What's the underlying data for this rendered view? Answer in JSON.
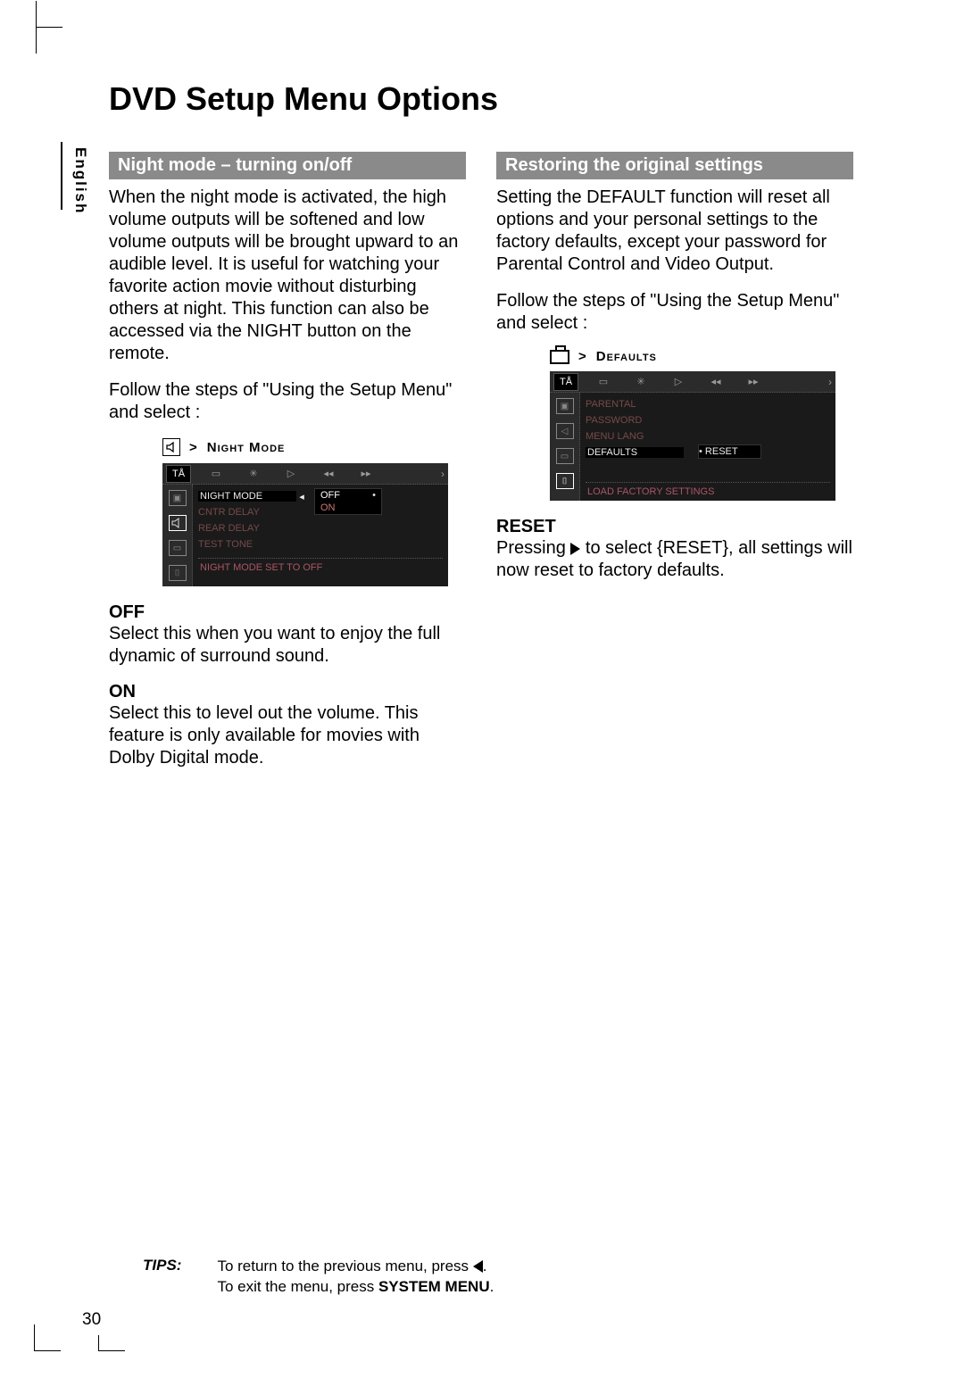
{
  "page": {
    "language": "English",
    "title": "DVD Setup Menu Options",
    "number": "30"
  },
  "left": {
    "heading": "Night mode – turning on/off",
    "p1": "When the night mode is activated, the high volume outputs will be softened and low volume outputs will be brought upward to an audible level.  It is useful for watching your favorite action movie without disturbing others at night. This function can also be accessed via the NIGHT button on the remote.",
    "p2": "Follow the steps of \"Using the Setup Menu\" and select :",
    "crumb": "Night Mode",
    "osd": {
      "rows": [
        "NIGHT MODE",
        "CNTR DELAY",
        "REAR DELAY",
        "TEST TONE"
      ],
      "opts": [
        "OFF",
        "ON"
      ],
      "status": "NIGHT MODE SET TO OFF"
    },
    "off_h": "Off",
    "off_p": "Select this when you want to enjoy the full dynamic of surround sound.",
    "on_h": "On",
    "on_p": "Select this to level out the volume. This feature is only available for movies with Dolby Digital mode."
  },
  "right": {
    "heading": "Restoring the original settings",
    "p1": "Setting the DEFAULT function will reset all options and your personal settings to the factory defaults, except your password for Parental Control and Video Output.",
    "p2": "Follow the steps of \"Using the Setup Menu\" and select :",
    "crumb": "Defaults",
    "osd": {
      "rows": [
        "PARENTAL",
        "PASSWORD",
        "MENU LANG",
        "DEFAULTS"
      ],
      "popup": "RESET",
      "status": "LOAD FACTORY SETTINGS"
    },
    "reset_h": "Reset",
    "reset_p_a": "Pressing ",
    "reset_p_b": " to select {RESET}, all settings will now reset to factory defaults."
  },
  "tips": {
    "label": "TIPS:",
    "line1a": "To return to the previous menu, press ",
    "line1b": ".",
    "line2a": "To  exit the menu, press ",
    "line2b": "SYSTEM MENU",
    "line2c": "."
  }
}
